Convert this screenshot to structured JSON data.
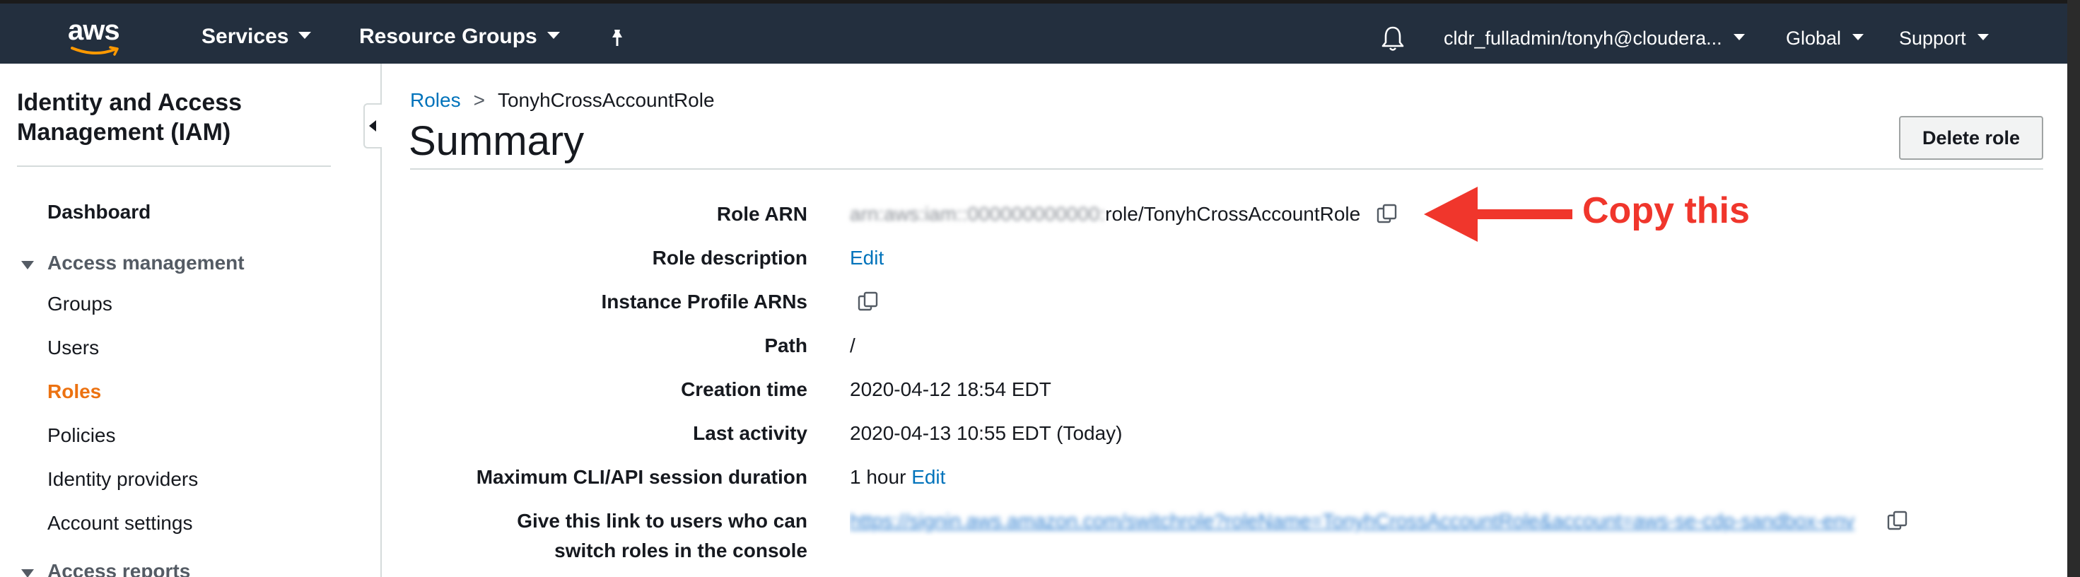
{
  "topnav": {
    "logo_text": "aws",
    "services_label": "Services",
    "resource_groups_label": "Resource Groups",
    "account_label": "cldr_fulladmin/tonyh@cloudera...",
    "region_label": "Global",
    "support_label": "Support",
    "background_color": "#232f3e"
  },
  "sidebar": {
    "title": "Identity and Access Management (IAM)",
    "dashboard_label": "Dashboard",
    "access_management": {
      "label": "Access management",
      "items": [
        {
          "label": "Groups",
          "active": false
        },
        {
          "label": "Users",
          "active": false
        },
        {
          "label": "Roles",
          "active": true
        },
        {
          "label": "Policies",
          "active": false
        },
        {
          "label": "Identity providers",
          "active": false
        },
        {
          "label": "Account settings",
          "active": false
        }
      ]
    },
    "access_reports_label": "Access reports",
    "active_color": "#ec7211"
  },
  "breadcrumb": {
    "parent": "Roles",
    "separator": ">",
    "current": "TonyhCrossAccountRole"
  },
  "page": {
    "title": "Summary",
    "delete_button_label": "Delete role"
  },
  "summary": {
    "role_arn": {
      "label": "Role ARN",
      "value_hidden": "arn:aws:iam::000000000000:",
      "value_visible": "role/TonyhCrossAccountRole"
    },
    "role_description": {
      "label": "Role description",
      "edit_label": "Edit"
    },
    "instance_profile_arns": {
      "label": "Instance Profile ARNs"
    },
    "path": {
      "label": "Path",
      "value": "/"
    },
    "creation_time": {
      "label": "Creation time",
      "value": "2020-04-12 18:54 EDT"
    },
    "last_activity": {
      "label": "Last activity",
      "value": "2020-04-13 10:55 EDT (Today)"
    },
    "max_session": {
      "label": "Maximum CLI/API session duration",
      "value": "1 hour",
      "edit_label": "Edit"
    },
    "switch_link": {
      "label_line1": "Give this link to users who can",
      "label_line2": "switch roles in the console",
      "value_hidden": "https://signin.aws.amazon.com/switchrole?roleName=TonyhCrossAccountRole&account=aws-se-cdp-sandbox-env"
    }
  },
  "annotation": {
    "text": "Copy this",
    "color": "#f0362c"
  }
}
